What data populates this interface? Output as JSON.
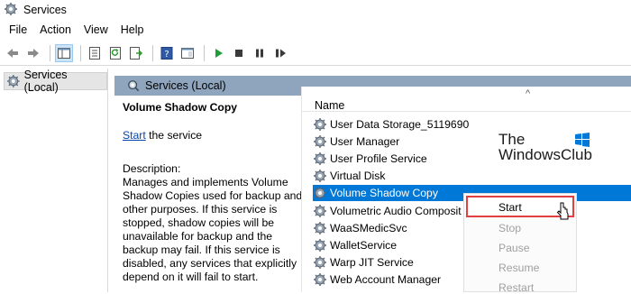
{
  "window": {
    "title": "Services"
  },
  "menu": [
    "File",
    "Action",
    "View",
    "Help"
  ],
  "tree": {
    "root_label": "Services (Local)"
  },
  "panel": {
    "header": "Services (Local)"
  },
  "description": {
    "service_name": "Volume Shadow Copy",
    "start_link": "Start",
    "start_suffix": " the service",
    "label": "Description:",
    "text": "Manages and implements Volume Shadow Copies used for backup and other purposes. If this service is stopped, shadow copies will be unavailable for backup and the backup may fail. If this service is disabled, any services that explicitly depend on it will fail to start."
  },
  "list": {
    "column_name": "Name",
    "sort_indicator": "^",
    "rows": [
      "User Data Storage_5119690",
      "User Manager",
      "User Profile Service",
      "Virtual Disk",
      "Volume Shadow Copy",
      "Volumetric Audio Composit",
      "WaaSMedicSvc",
      "WalletService",
      "Warp JIT Service",
      "Web Account Manager"
    ],
    "selected_index": 4
  },
  "watermark": {
    "line1": "The",
    "line2": "WindowsClub"
  },
  "context_menu": {
    "items": [
      "Start",
      "Stop",
      "Pause",
      "Resume",
      "Restart"
    ],
    "highlighted": "Start"
  },
  "colors": {
    "selection": "#0078d7",
    "header": "#8fa5bd",
    "highlight_border": "#e04040"
  }
}
